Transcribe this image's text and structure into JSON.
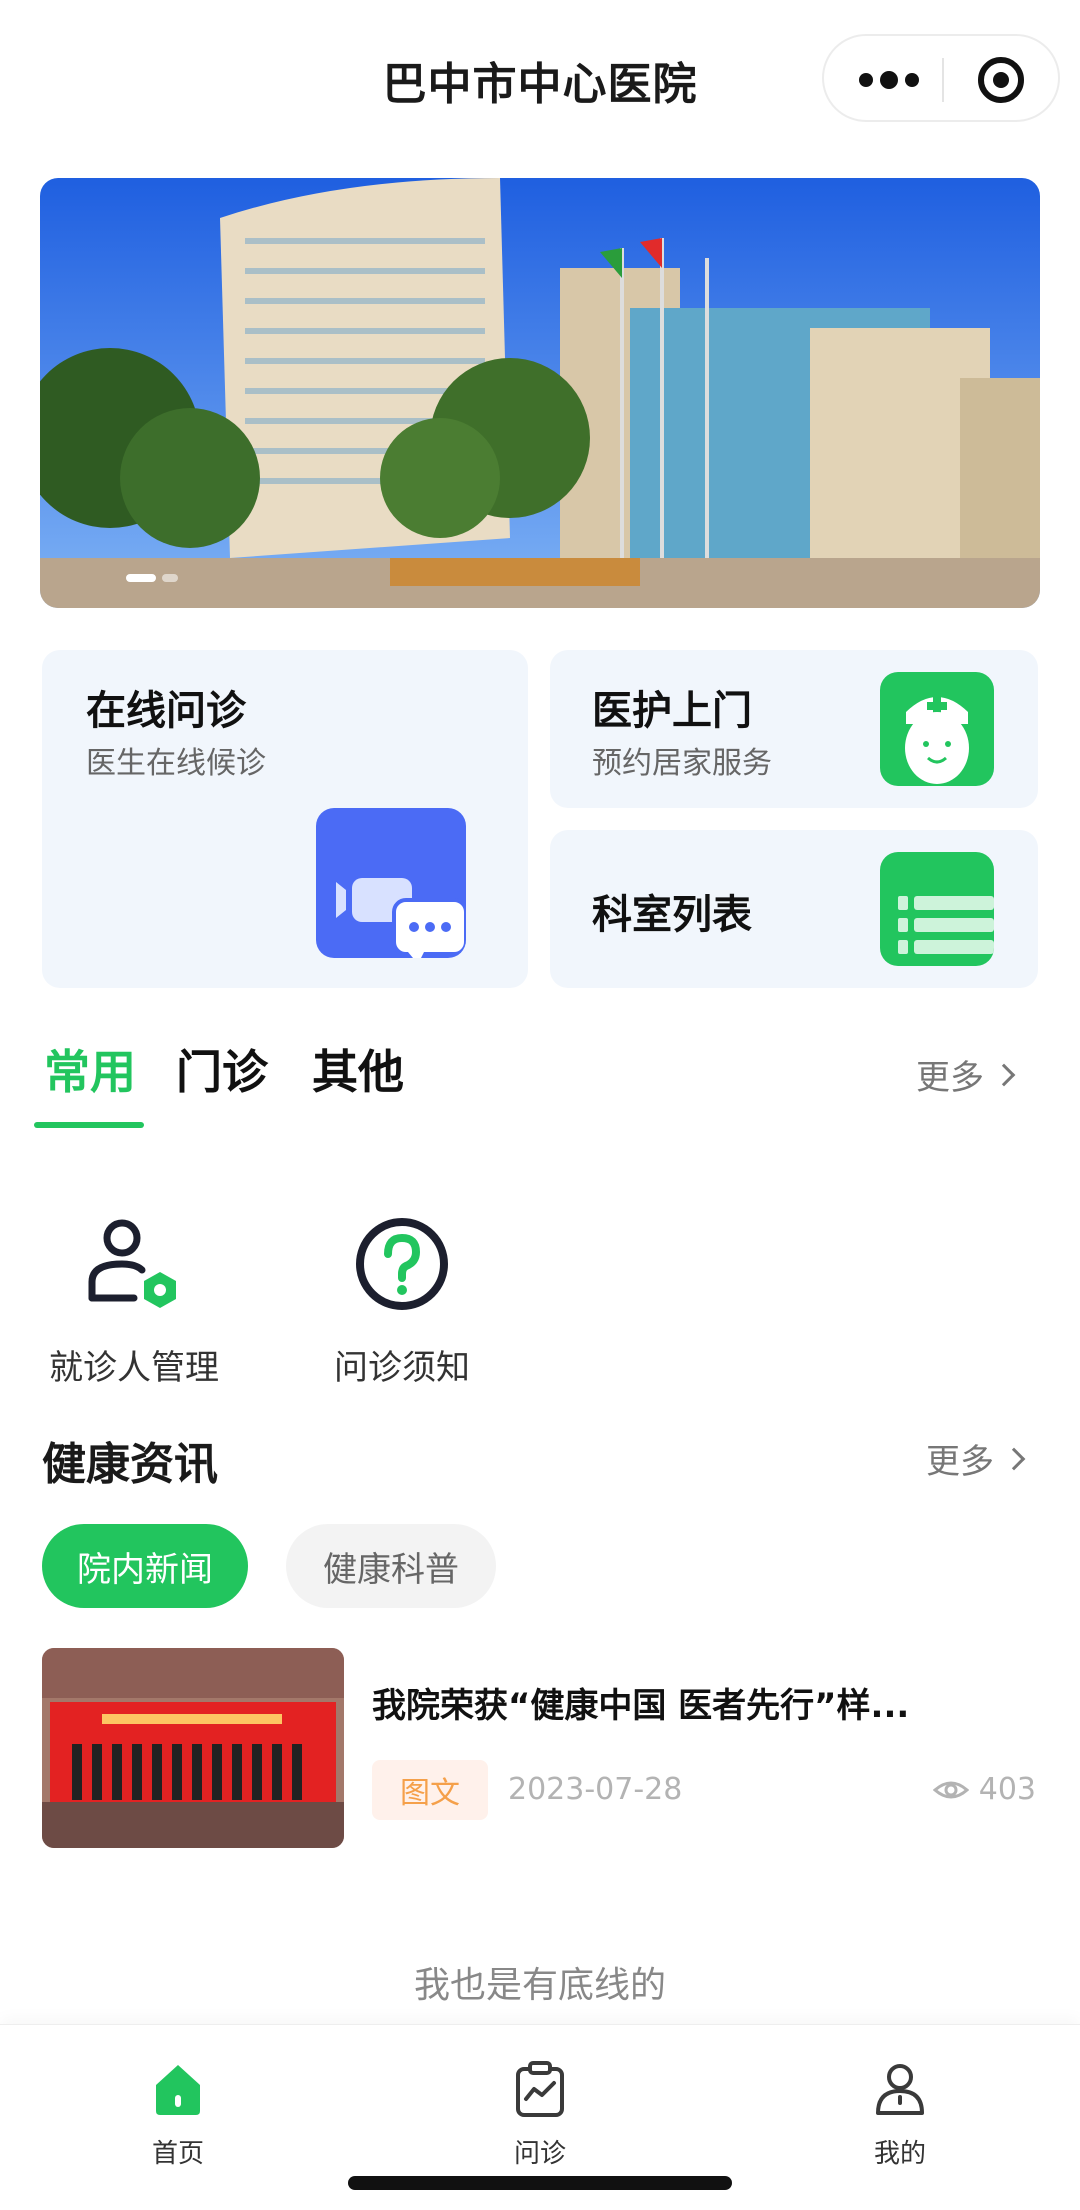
{
  "header": {
    "title": "巴中市中心医院"
  },
  "feature_cards": {
    "online": {
      "title": "在线问诊",
      "subtitle": "医生在线候诊"
    },
    "home_care": {
      "title": "医护上门",
      "subtitle": "预约居家服务"
    },
    "departments": {
      "title": "科室列表"
    }
  },
  "service_tabs": {
    "tabs": [
      "常用",
      "门诊",
      "其他"
    ],
    "active_tab": "常用",
    "more": "更多"
  },
  "quick_actions": [
    {
      "label": "就诊人管理",
      "icon": "patient-manage-icon"
    },
    {
      "label": "问诊须知",
      "icon": "question-circle-icon"
    }
  ],
  "health_news": {
    "title": "健康资讯",
    "more": "更多",
    "filters": [
      "院内新闻",
      "健康科普"
    ],
    "active_filter": "院内新闻",
    "items": [
      {
        "title": "我院荣获“健康中国 医者先行”样...",
        "tag": "图文",
        "date": "2023-07-28",
        "views": "403"
      }
    ]
  },
  "footer_note": "我也是有底线的",
  "tabbar": [
    {
      "label": "首页",
      "icon": "home-icon",
      "active": true
    },
    {
      "label": "问诊",
      "icon": "consult-icon",
      "active": false
    },
    {
      "label": "我的",
      "icon": "profile-icon",
      "active": false
    }
  ],
  "colors": {
    "accent": "#22c55e",
    "card_bg": "#f1f6fc",
    "video_icon": "#4b6bf5",
    "tag_text": "#f5a04a"
  }
}
